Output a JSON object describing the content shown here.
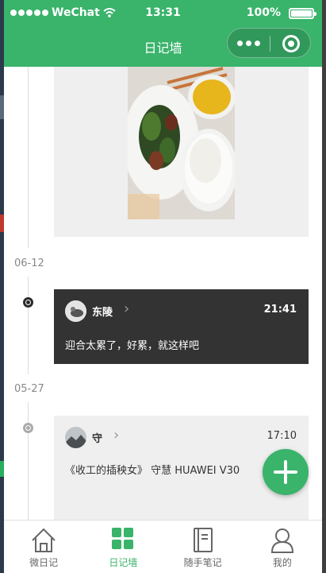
{
  "status_bar": {
    "carrier": "WeChat",
    "time": "13:31",
    "battery": "100%",
    "battery_level": 1.0
  },
  "navbar": {
    "title": "日记墙"
  },
  "entries": [
    {
      "date": "06-12",
      "author": "东陵",
      "time": "21:41",
      "text": "迎合太累了，好累，就这样吧",
      "theme": "dark"
    },
    {
      "date": "05-27",
      "author": "守",
      "time": "17:10",
      "text": "《收工的插秧女》 守慧 HUAWEI V30",
      "theme": "light"
    }
  ],
  "tabs": [
    {
      "label": "微日记",
      "icon": "home-icon",
      "active": false
    },
    {
      "label": "日记墙",
      "icon": "grid-icon",
      "active": true
    },
    {
      "label": "随手笔记",
      "icon": "notebook-icon",
      "active": false
    },
    {
      "label": "我的",
      "icon": "user-icon",
      "active": false
    }
  ],
  "colors": {
    "brand": "#3ab36b",
    "dark_card": "#333333",
    "light_card": "#efefef"
  }
}
